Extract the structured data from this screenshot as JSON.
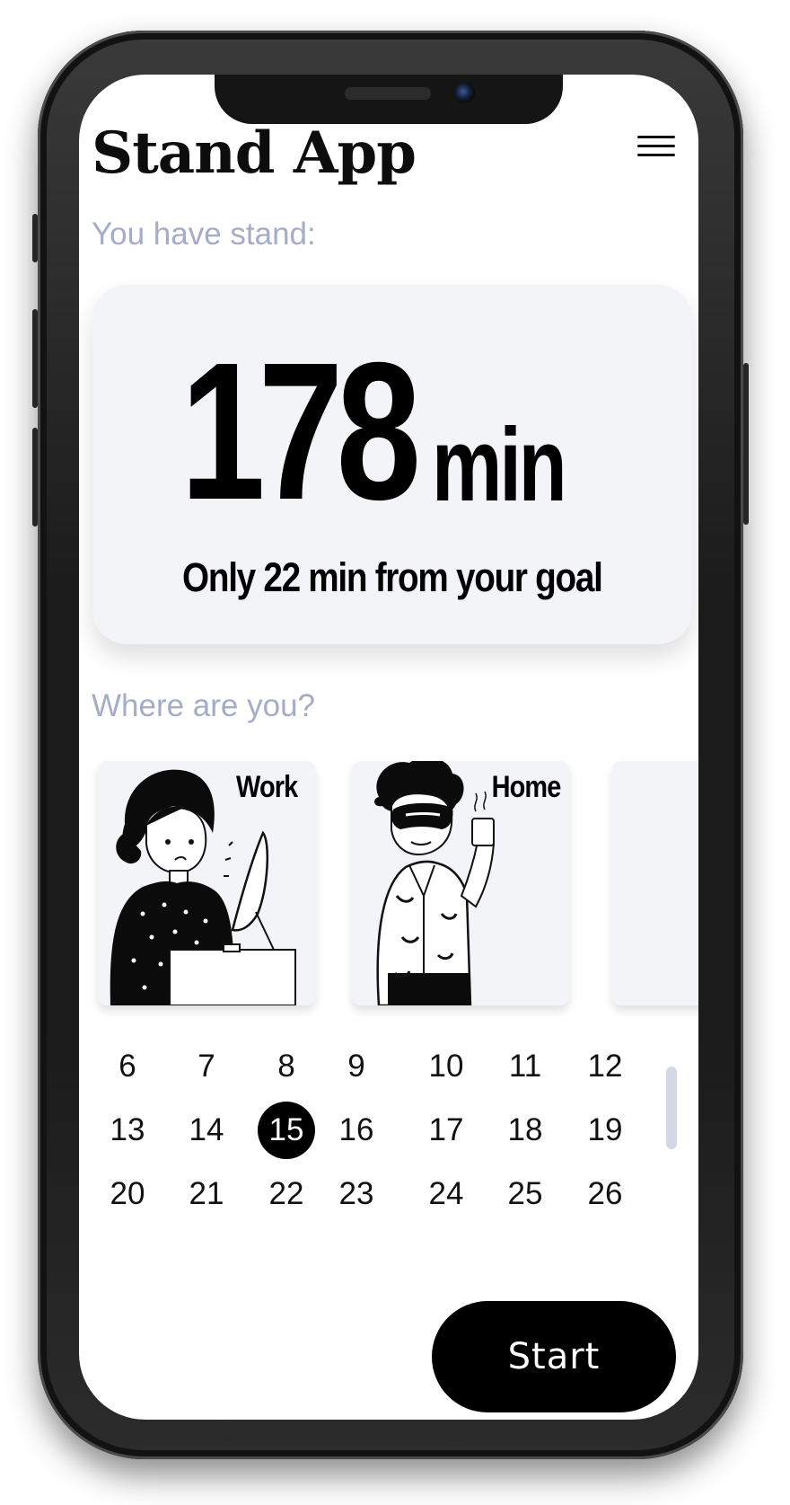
{
  "app": {
    "title": "Stand App"
  },
  "summary": {
    "label": "You have stand:",
    "minutes": "178",
    "unit": "min",
    "goal_text": "Only 22 min from your goal"
  },
  "locations": {
    "label": "Where are you?",
    "options": [
      {
        "label": "Work",
        "icon": "woman-at-computer-illustration"
      },
      {
        "label": "Home",
        "icon": "man-with-coffee-illustration"
      },
      {
        "label": "",
        "icon": ""
      }
    ]
  },
  "calendar": {
    "rows": [
      [
        "6",
        "7",
        "8",
        "9",
        "10",
        "11",
        "12"
      ],
      [
        "13",
        "14",
        "15",
        "16",
        "17",
        "18",
        "19"
      ],
      [
        "20",
        "21",
        "22",
        "23",
        "24",
        "25",
        "26"
      ]
    ],
    "selected_day": "15"
  },
  "actions": {
    "start_label": "Start"
  },
  "colors": {
    "accent": "#000000",
    "label": "#a3adc8",
    "card_bg": "#f3f4f8"
  }
}
